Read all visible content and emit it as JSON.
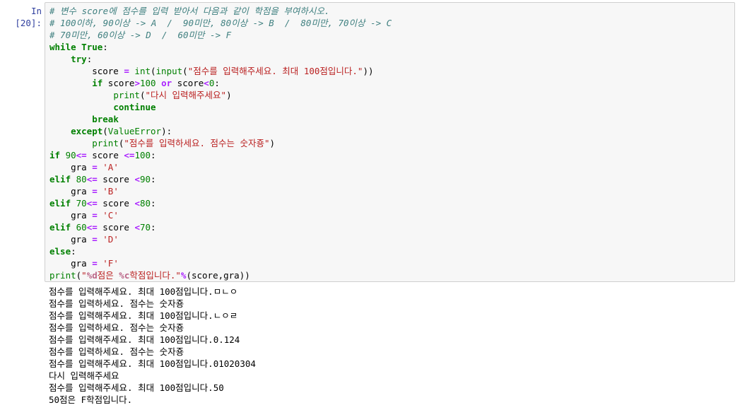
{
  "cell": {
    "prompt": "In [20]:",
    "code_lines": [
      [
        {
          "t": "# 변수 score에 점수를 입력 받아서 다음과 같이 학점을 부여하시오.",
          "c": "cm"
        }
      ],
      [
        {
          "t": "# 100이하, 90이상 -> A  /  90미만, 80이상 -> B  /  80미만, 70이상 -> C",
          "c": "cm"
        }
      ],
      [
        {
          "t": "# 70미만, 60이상 -> D  /  60미만 -> F",
          "c": "cm"
        }
      ],
      [
        {
          "t": "while",
          "c": "kw"
        },
        {
          "t": " "
        },
        {
          "t": "True",
          "c": "kw"
        },
        {
          "t": ":"
        }
      ],
      [
        {
          "t": "    "
        },
        {
          "t": "try",
          "c": "kw"
        },
        {
          "t": ":"
        }
      ],
      [
        {
          "t": "        score "
        },
        {
          "t": "=",
          "c": "op"
        },
        {
          "t": " "
        },
        {
          "t": "int",
          "c": "bi"
        },
        {
          "t": "("
        },
        {
          "t": "input",
          "c": "bi"
        },
        {
          "t": "("
        },
        {
          "t": "\"점수를 입력해주세요. 최대 100점입니다.\"",
          "c": "st"
        },
        {
          "t": "))"
        }
      ],
      [
        {
          "t": "        "
        },
        {
          "t": "if",
          "c": "kw"
        },
        {
          "t": " score"
        },
        {
          "t": ">",
          "c": "op"
        },
        {
          "t": "100",
          "c": "nu"
        },
        {
          "t": " "
        },
        {
          "t": "or",
          "c": "op"
        },
        {
          "t": " score"
        },
        {
          "t": "<",
          "c": "op"
        },
        {
          "t": "0",
          "c": "nu"
        },
        {
          "t": ":"
        }
      ],
      [
        {
          "t": "            "
        },
        {
          "t": "print",
          "c": "bi"
        },
        {
          "t": "("
        },
        {
          "t": "\"다시 입력해주세요\"",
          "c": "st"
        },
        {
          "t": ")"
        }
      ],
      [
        {
          "t": "            "
        },
        {
          "t": "continue",
          "c": "kw"
        }
      ],
      [
        {
          "t": "        "
        },
        {
          "t": "break",
          "c": "kw"
        }
      ],
      [
        {
          "t": "    "
        },
        {
          "t": "except",
          "c": "kw"
        },
        {
          "t": "("
        },
        {
          "t": "ValueError",
          "c": "bi"
        },
        {
          "t": "):"
        }
      ],
      [
        {
          "t": "        "
        },
        {
          "t": "print",
          "c": "bi"
        },
        {
          "t": "("
        },
        {
          "t": "\"점수를 입력하세요. 점수는 숫자죵\"",
          "c": "st"
        },
        {
          "t": ")"
        }
      ],
      [
        {
          "t": "if",
          "c": "kw"
        },
        {
          "t": " "
        },
        {
          "t": "90",
          "c": "nu"
        },
        {
          "t": "<=",
          "c": "op"
        },
        {
          "t": " score "
        },
        {
          "t": "<=",
          "c": "op"
        },
        {
          "t": "100",
          "c": "nu"
        },
        {
          "t": ":"
        }
      ],
      [
        {
          "t": "    gra "
        },
        {
          "t": "=",
          "c": "op"
        },
        {
          "t": " "
        },
        {
          "t": "'A'",
          "c": "st"
        }
      ],
      [
        {
          "t": "elif",
          "c": "kw"
        },
        {
          "t": " "
        },
        {
          "t": "80",
          "c": "nu"
        },
        {
          "t": "<=",
          "c": "op"
        },
        {
          "t": " score "
        },
        {
          "t": "<",
          "c": "op"
        },
        {
          "t": "90",
          "c": "nu"
        },
        {
          "t": ":"
        }
      ],
      [
        {
          "t": "    gra "
        },
        {
          "t": "=",
          "c": "op"
        },
        {
          "t": " "
        },
        {
          "t": "'B'",
          "c": "st"
        }
      ],
      [
        {
          "t": "elif",
          "c": "kw"
        },
        {
          "t": " "
        },
        {
          "t": "70",
          "c": "nu"
        },
        {
          "t": "<=",
          "c": "op"
        },
        {
          "t": " score "
        },
        {
          "t": "<",
          "c": "op"
        },
        {
          "t": "80",
          "c": "nu"
        },
        {
          "t": ":"
        }
      ],
      [
        {
          "t": "    gra "
        },
        {
          "t": "=",
          "c": "op"
        },
        {
          "t": " "
        },
        {
          "t": "'C'",
          "c": "st"
        }
      ],
      [
        {
          "t": "elif",
          "c": "kw"
        },
        {
          "t": " "
        },
        {
          "t": "60",
          "c": "nu"
        },
        {
          "t": "<=",
          "c": "op"
        },
        {
          "t": " score "
        },
        {
          "t": "<",
          "c": "op"
        },
        {
          "t": "70",
          "c": "nu"
        },
        {
          "t": ":"
        }
      ],
      [
        {
          "t": "    gra "
        },
        {
          "t": "=",
          "c": "op"
        },
        {
          "t": " "
        },
        {
          "t": "'D'",
          "c": "st"
        }
      ],
      [
        {
          "t": "else",
          "c": "kw"
        },
        {
          "t": ":"
        }
      ],
      [
        {
          "t": "    gra "
        },
        {
          "t": "=",
          "c": "op"
        },
        {
          "t": " "
        },
        {
          "t": "'F'",
          "c": "st"
        }
      ],
      [
        {
          "t": "print",
          "c": "bi"
        },
        {
          "t": "("
        },
        {
          "t": "\"",
          "c": "st"
        },
        {
          "t": "%d",
          "c": "sp"
        },
        {
          "t": "점은 ",
          "c": "st"
        },
        {
          "t": "%c",
          "c": "sp"
        },
        {
          "t": "학점입니다.\"",
          "c": "st"
        },
        {
          "t": "%",
          "c": "op"
        },
        {
          "t": "(score,gra))"
        }
      ]
    ],
    "output_lines": [
      "점수를 입력해주세요. 최대 100점입니다.ㅁㄴㅇ",
      "점수를 입력하세요. 점수는 숫자죵",
      "점수를 입력해주세요. 최대 100점입니다.ㄴㅇㄹ",
      "점수를 입력하세요. 점수는 숫자죵",
      "점수를 입력해주세요. 최대 100점입니다.0.124",
      "점수를 입력하세요. 점수는 숫자죵",
      "점수를 입력해주세요. 최대 100점입니다.01020304",
      "다시 입력해주세요",
      "점수를 입력해주세요. 최대 100점입니다.50",
      "50점은 F학점입니다."
    ]
  }
}
